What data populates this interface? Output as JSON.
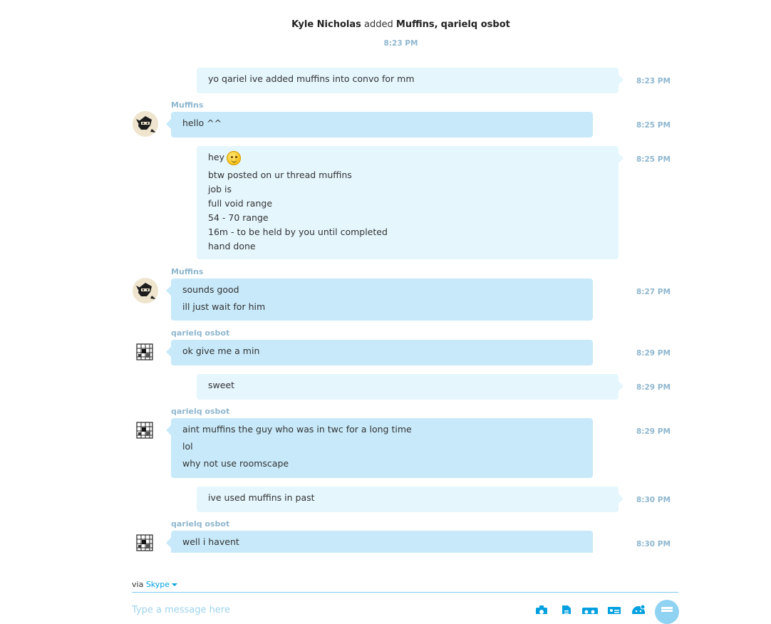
{
  "header": {
    "actor": "Kyle Nicholas",
    "verb": "added",
    "added_1": "Muffins",
    "separator": ",",
    "added_2": "qarielq osbot",
    "time": "8:23 PM"
  },
  "messages": [
    {
      "dir": "out",
      "lines": [
        "yo qariel ive added muffins into convo for mm"
      ],
      "time": "8:23 PM"
    },
    {
      "dir": "in",
      "sender": "Muffins",
      "lines": [
        "hello ^^"
      ],
      "time": "8:25 PM"
    },
    {
      "dir": "out",
      "lines": [
        "hey",
        "btw posted on ur thread muffins",
        "job is",
        "full void range",
        "54 - 70 range",
        "16m - to be held by you until completed",
        "hand done"
      ],
      "time": "8:25 PM",
      "emoticon": "smile-emoticon-icon"
    },
    {
      "dir": "in",
      "sender": "Muffins",
      "lines": [
        "sounds good",
        "ill just wait for him"
      ],
      "time": "8:27 PM"
    },
    {
      "dir": "in",
      "sender": "qarielq osbot",
      "lines": [
        "ok give me a min"
      ],
      "time": "8:29 PM"
    },
    {
      "dir": "out",
      "lines": [
        "sweet"
      ],
      "time": "8:29 PM"
    },
    {
      "dir": "in",
      "sender": "qarielq osbot",
      "lines": [
        "aint muffins the guy who was in twc for a long time",
        "lol",
        "why not use roomscape"
      ],
      "time": "8:29 PM"
    },
    {
      "dir": "out",
      "lines": [
        "ive used muffins in past"
      ],
      "time": "8:30 PM"
    },
    {
      "dir": "in",
      "sender": "qarielq osbot",
      "lines": [
        "well i havent"
      ],
      "time": "8:30 PM"
    }
  ],
  "footer": {
    "via_label": "via",
    "via_service": "Skype",
    "compose_placeholder": "Type a message here",
    "tools": [
      "photo-icon",
      "file-icon",
      "video-icon",
      "contact-card-icon",
      "emoticon-icon"
    ],
    "send_icon": "send-icon"
  },
  "colors": {
    "outgoing_bubble": "#e5f6fd",
    "incoming_bubble": "#c7e9f9",
    "meta_text": "#8fb7cf",
    "accent": "#00a0e0"
  }
}
